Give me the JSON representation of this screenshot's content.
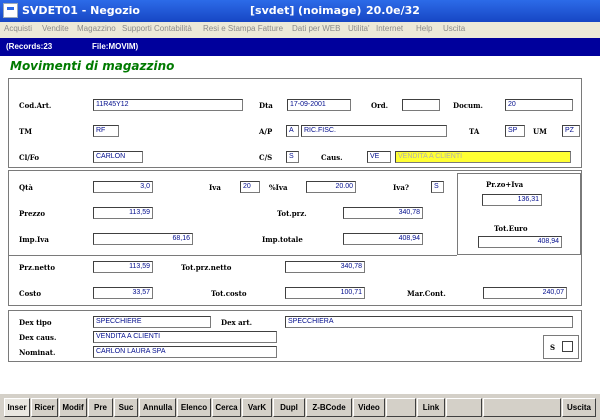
{
  "window": {
    "title": "SVDET01 - Negozio",
    "host": "[svdet]",
    "image_flag": "(noimage)",
    "version": "20.0e/32"
  },
  "menu": [
    "Acquisti",
    "Vendite",
    "Magazzino",
    "Supporti Contabilità",
    "Resi e Stampa Fatture",
    "Dati per WEB",
    "Utilita'",
    "Internet",
    "Help",
    "Uscita"
  ],
  "status": {
    "records": "(Records:23",
    "file": "File:MOVIM)"
  },
  "form": {
    "title": "Movimenti di magazzino",
    "cod_art_label": "Cod.Art.",
    "cod_art": "11R45Y12",
    "dta_label": "Dta",
    "dta": "17-09-2001",
    "ord_label": "Ord.",
    "ord": "",
    "docum_label": "Docum.",
    "docum": "20",
    "tm_label": "TM",
    "tm": "RF",
    "ap_label": "A/P",
    "ap": "A",
    "ap_desc": "RIC.FISC.",
    "ta_label": "TA",
    "ta": "SP",
    "um_label": "UM",
    "um": "PZ",
    "clfo_label": "Cl/Fo",
    "clfo": "CARLON",
    "cs_label": "C/S",
    "cs": "S",
    "caus_label": "Caus.",
    "caus": "VE",
    "caus_desc": "VENDITA A CLIENTI",
    "qta_label": "Qtà",
    "qta": "3,0",
    "iva_label": "Iva",
    "iva": "20",
    "pct_iva_label": "%Iva",
    "pct_iva": "20.00",
    "iva_q_label": "Iva?",
    "iva_q": "S",
    "przivaLabel": "Pr.zo+Iva",
    "prz_iva": "136,31",
    "prezzo_label": "Prezzo",
    "prezzo": "113,59",
    "tot_prz_label": "Tot.prz.",
    "tot_prz": "340,78",
    "tot_euro_label": "Tot.Euro",
    "tot_euro": "408,94",
    "imp_iva_label": "Imp.Iva",
    "imp_iva": "68,16",
    "imp_totale_label": "Imp.totale",
    "imp_totale": "408,94",
    "prz_netto_label": "Prz.netto",
    "prz_netto": "113,59",
    "tot_prz_netto_label": "Tot.prz.netto",
    "tot_prz_netto": "340,78",
    "costo_label": "Costo",
    "costo": "33,57",
    "tot_costo_label": "Tot.costo",
    "tot_costo": "100,71",
    "mar_cont_label": "Mar.Cont.",
    "mar_cont": "240,07",
    "dex_tipo_label": "Dex tipo",
    "dex_tipo": "SPECCHIERE",
    "dex_art_label": "Dex art.",
    "dex_art": "SPECCHIERA",
    "dex_caus_label": "Dex caus.",
    "dex_caus": "VENDITA A CLIENTI",
    "nominat_label": "Nominat.",
    "nominat": "CARLON LAURA SPA",
    "s_label": "S"
  },
  "toolbar": [
    "Inser",
    "Ricer",
    "Modif",
    "Pre",
    "Suc",
    "Annulla",
    "Elenco",
    "Cerca",
    "VarK",
    "Dupl",
    "Z-BCode",
    "Video",
    "",
    "Link",
    "",
    "",
    "Uscita"
  ]
}
